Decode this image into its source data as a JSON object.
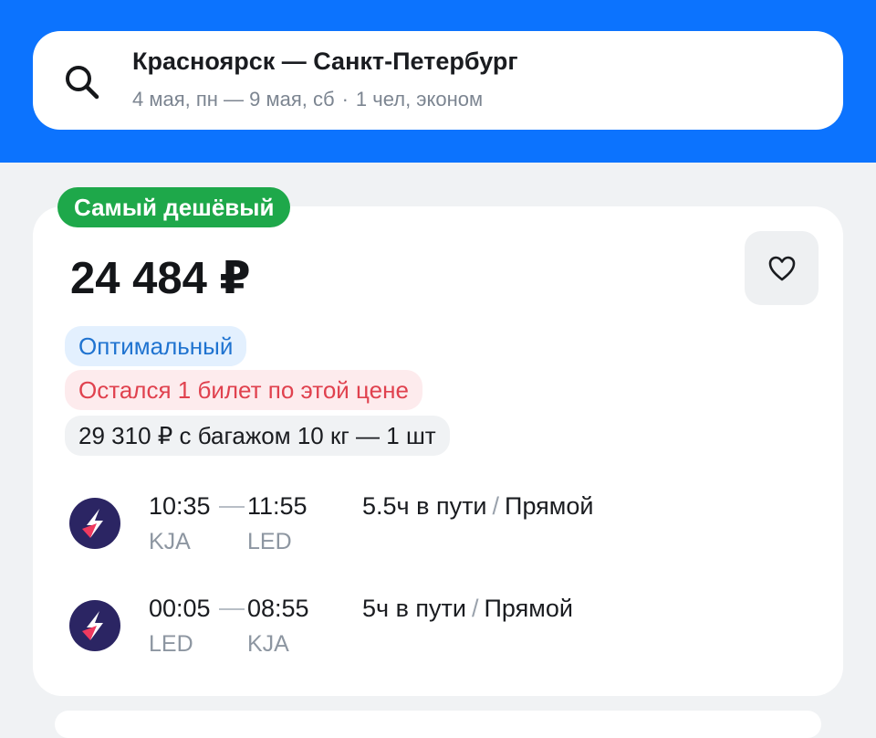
{
  "search": {
    "route": "Красноярск — Санкт-Петербург",
    "dates": "4 мая, пн — 9 мая, сб",
    "passengers": "1 чел, эконом",
    "icon": "search-icon"
  },
  "offer": {
    "badge": "Самый дешёвый",
    "price": "24 484 ₽",
    "tags": {
      "optimal": "Оптимальный",
      "last_ticket": "Остался 1 билет по этой цене",
      "baggage": "29 310 ₽ с багажом 10 кг — 1 шт"
    },
    "favorite_icon": "heart-icon",
    "segments": [
      {
        "airline_icon": "airline-logo",
        "depart_time": "10:35",
        "arrive_time": "11:55",
        "from": "KJA",
        "to": "LED",
        "duration": "5.5ч в пути",
        "stops": "Прямой"
      },
      {
        "airline_icon": "airline-logo",
        "depart_time": "00:05",
        "arrive_time": "08:55",
        "from": "LED",
        "to": "KJA",
        "duration": "5ч в пути",
        "stops": "Прямой"
      }
    ]
  },
  "colors": {
    "header": "#0c73fe",
    "badge_green": "#1ea84a",
    "optimal_blue": "#1f73d0",
    "warning_red": "#e0414e",
    "logo_bg": "#2b2563",
    "logo_accent": "#f03a5f"
  }
}
